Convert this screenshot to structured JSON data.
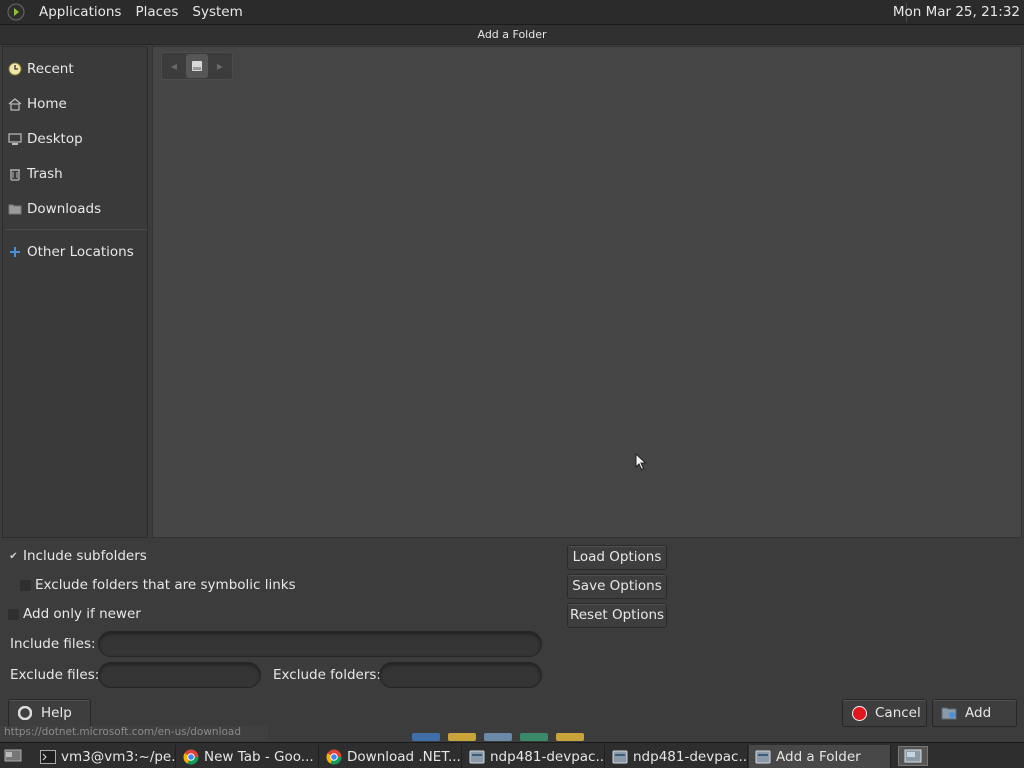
{
  "top_panel": {
    "menus": [
      "Applications",
      "Places",
      "System"
    ],
    "clock": "Mon Mar 25, 21:32"
  },
  "dialog": {
    "title": "Add a Folder"
  },
  "sidebar": {
    "items": [
      {
        "label": "Recent",
        "icon": "clock-icon"
      },
      {
        "label": "Home",
        "icon": "home-icon"
      },
      {
        "label": "Desktop",
        "icon": "desktop-icon"
      },
      {
        "label": "Trash",
        "icon": "trash-icon"
      },
      {
        "label": "Downloads",
        "icon": "folder-icon"
      },
      {
        "label": "Other Locations",
        "icon": "plus-icon"
      }
    ]
  },
  "options": {
    "include_subfolders": {
      "label": "Include subfolders",
      "checked": true
    },
    "exclude_symlinks": {
      "label": "Exclude folders that are symbolic links",
      "checked": false
    },
    "add_if_newer": {
      "label": "Add only if newer",
      "checked": false
    },
    "load_label": "Load Options",
    "save_label": "Save Options",
    "reset_label": "Reset Options",
    "include_files_label": "Include files:",
    "include_files_value": "",
    "exclude_files_label": "Exclude files:",
    "exclude_files_value": "",
    "exclude_folders_label": "Exclude folders:",
    "exclude_folders_value": ""
  },
  "buttons": {
    "help": "Help",
    "cancel": "Cancel",
    "add": "Add"
  },
  "status_url": "https://dotnet.microsoft.com/en-us/download",
  "taskbar": {
    "items": [
      {
        "label": "vm3@vm3:~/pe...",
        "icon": "terminal-icon"
      },
      {
        "label": "New Tab - Goo...",
        "icon": "chrome-icon"
      },
      {
        "label": "Download .NET...",
        "icon": "chrome-icon"
      },
      {
        "label": "ndp481-devpac...",
        "icon": "app-icon"
      },
      {
        "label": "ndp481-devpac...",
        "icon": "app-icon"
      },
      {
        "label": "Add a Folder",
        "icon": "app-icon"
      }
    ]
  },
  "colors": {
    "panel_bg": "#2b2b2b",
    "dialog_bg": "#3c3c3c",
    "file_area_bg": "#454545",
    "cancel_red": "#e0161c",
    "accent_blue": "#4a90d9"
  }
}
